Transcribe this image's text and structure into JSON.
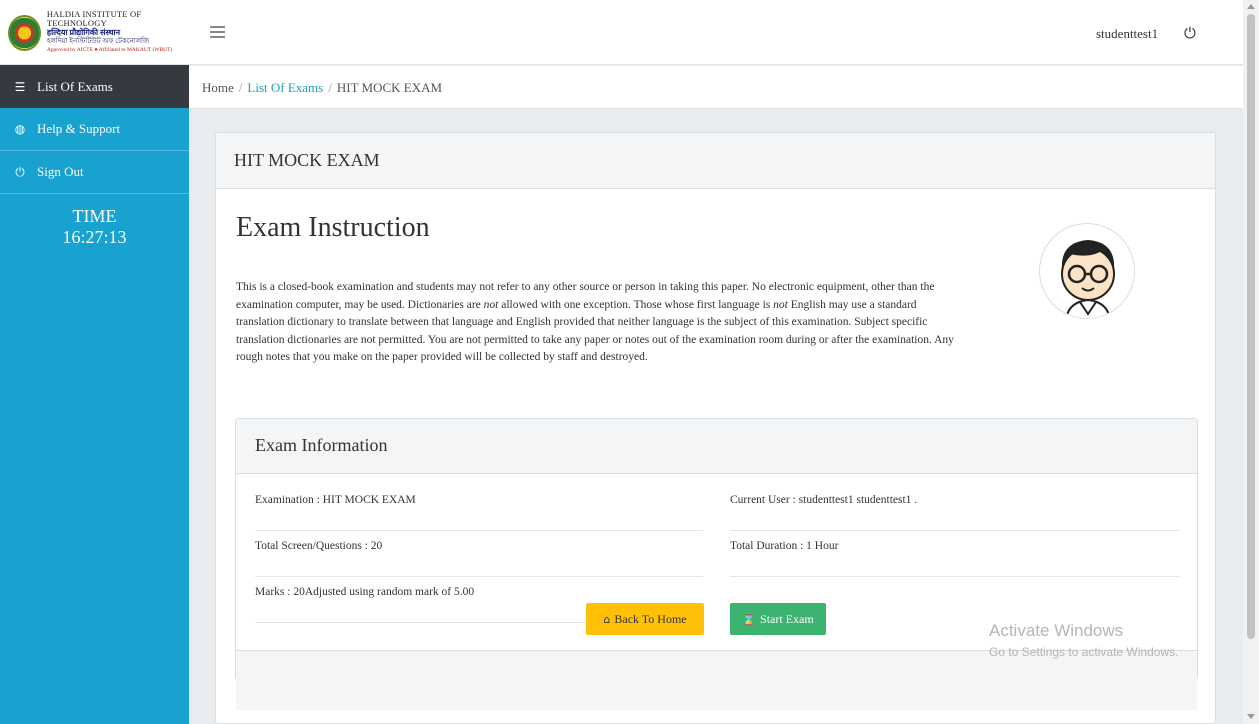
{
  "header": {
    "logo_lines": [
      "HALDIA INSTITUTE OF TECHNOLOGY",
      "हल्दिया प्रौद्योगिकी संस्थान",
      "হলদিয়া ইনস্টিটিউট অফ টেকনোলজি",
      "Approved by AICTE ● Affiliated to MAKAUT (WBUT)"
    ],
    "username": "studenttest1"
  },
  "sidebar": {
    "items": [
      {
        "label": "List Of Exams",
        "icon": "list-icon"
      },
      {
        "label": "Help & Support",
        "icon": "life-ring-icon"
      },
      {
        "label": "Sign Out",
        "icon": "power-icon"
      }
    ],
    "time_label": "TIME",
    "time_value": "16:27:13"
  },
  "breadcrumb": {
    "home": "Home",
    "list": "List Of Exams",
    "current": "HIT MOCK EXAM",
    "separator": "/"
  },
  "card": {
    "title": "HIT MOCK EXAM",
    "instruction_title": "Exam Instruction",
    "instruction_parts": [
      "This is a closed-book examination and students may not refer to any other source or person in taking this paper. No electronic equipment, other than the examination computer, may be used. Dictionaries are ",
      "not",
      " allowed with one exception. Those whose first language is ",
      "not",
      " English may use a standard translation dictionary to translate between that language and English provided that neither language is the subject of this examination. Subject specific translation dictionaries are not permitted. You are not permitted to take any paper or notes out of the examination room during or after the examination. Any rough notes that you make on the paper provided will be collected by staff and destroyed."
    ]
  },
  "exam_info": {
    "title": "Exam Information",
    "examination": "Examination : HIT MOCK EXAM",
    "current_user": "Current User : studenttest1 studenttest1 .",
    "total_questions": "Total Screen/Questions : 20",
    "total_duration": "Total Duration : 1 Hour",
    "marks": "Marks : 20Adjusted using random mark of 5.00"
  },
  "buttons": {
    "back_home": "Back To Home",
    "start_exam": "Start Exam"
  },
  "watermark": {
    "line1": "Activate Windows",
    "line2": "Go to Settings to activate Windows."
  },
  "colors": {
    "sidebar": "#17a2d0",
    "sidebar_active": "#343a40",
    "back_button": "#ffc107",
    "start_button": "#3cb371",
    "link": "#17a2b8"
  }
}
